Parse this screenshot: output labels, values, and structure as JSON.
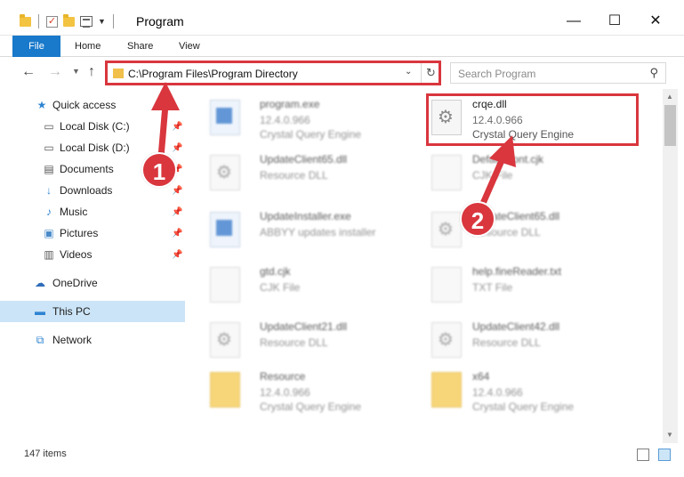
{
  "window": {
    "title": "Program",
    "controls": [
      "minimize",
      "maximize",
      "close"
    ]
  },
  "ribbon": {
    "tabs": [
      "File",
      "Home",
      "Share",
      "View"
    ]
  },
  "address_bar": {
    "path": "C:\\Program Files\\Program Directory"
  },
  "search": {
    "placeholder": "Search Program"
  },
  "sidebar": {
    "items": [
      {
        "label": "Quick access",
        "icon": "star-icon",
        "pinned": false
      },
      {
        "label": "Local Disk (C:)",
        "icon": "drive-icon",
        "pinned": true
      },
      {
        "label": "Local Disk (D:)",
        "icon": "drive-icon",
        "pinned": true
      },
      {
        "label": "Documents",
        "icon": "documents-icon",
        "pinned": true
      },
      {
        "label": "Downloads",
        "icon": "download-icon",
        "pinned": true
      },
      {
        "label": "Music",
        "icon": "music-icon",
        "pinned": true
      },
      {
        "label": "Pictures",
        "icon": "pictures-icon",
        "pinned": true
      },
      {
        "label": "Videos",
        "icon": "videos-icon",
        "pinned": true
      },
      {
        "label": "OneDrive",
        "icon": "cloud-icon",
        "pinned": false
      },
      {
        "label": "This PC",
        "icon": "computer-icon",
        "pinned": false,
        "selected": true
      },
      {
        "label": "Network",
        "icon": "network-icon",
        "pinned": false
      }
    ]
  },
  "files": [
    {
      "name": "program.exe",
      "line1": "12.4.0.966",
      "line2": "Crystal Query Engine",
      "icon": "application-icon",
      "blurred": true
    },
    {
      "name": "crqe.dll",
      "line1": "12.4.0.966",
      "line2": "Crystal Query Engine",
      "icon": "dll-gear-icon",
      "blurred": false,
      "highlighted": true
    },
    {
      "name": "UpdateClient65.dll",
      "line1": "Resource DLL",
      "line2": "",
      "icon": "dll-gear-icon",
      "blurred": true
    },
    {
      "name": "DefaultFont.cjk",
      "line1": "CJK File",
      "line2": "",
      "icon": "file-icon",
      "blurred": true
    },
    {
      "name": "UpdateInstaller.exe",
      "line1": "ABBYY updates installer",
      "line2": "",
      "icon": "installer-icon",
      "blurred": true
    },
    {
      "name": "UpdateClient65.dll",
      "line1": "Resource DLL",
      "line2": "",
      "icon": "dll-gear-icon",
      "blurred": true
    },
    {
      "name": "gtd.cjk",
      "line1": "CJK File",
      "line2": "",
      "icon": "file-icon",
      "blurred": true
    },
    {
      "name": "help.fineReader.txt",
      "line1": "TXT File",
      "line2": "",
      "icon": "file-icon",
      "blurred": true
    },
    {
      "name": "UpdateClient21.dll",
      "line1": "Resource DLL",
      "line2": "",
      "icon": "dll-gear-icon",
      "blurred": true
    },
    {
      "name": "UpdateClient42.dll",
      "line1": "Resource DLL",
      "line2": "",
      "icon": "dll-gear-icon",
      "blurred": true
    },
    {
      "name": "Resource",
      "line1": "12.4.0.966",
      "line2": "Crystal Query Engine",
      "icon": "folder-icon",
      "blurred": true
    },
    {
      "name": "x64",
      "line1": "12.4.0.966",
      "line2": "Crystal Query Engine",
      "icon": "folder-icon",
      "blurred": true
    }
  ],
  "status": {
    "item_count": "147 items"
  },
  "annotations": [
    {
      "number": "1",
      "color": "#d9363e"
    },
    {
      "number": "2",
      "color": "#d9363e"
    }
  ],
  "colors": {
    "accent": "#1979ca",
    "highlight": "#d9363e",
    "selected": "#cce4f7"
  }
}
